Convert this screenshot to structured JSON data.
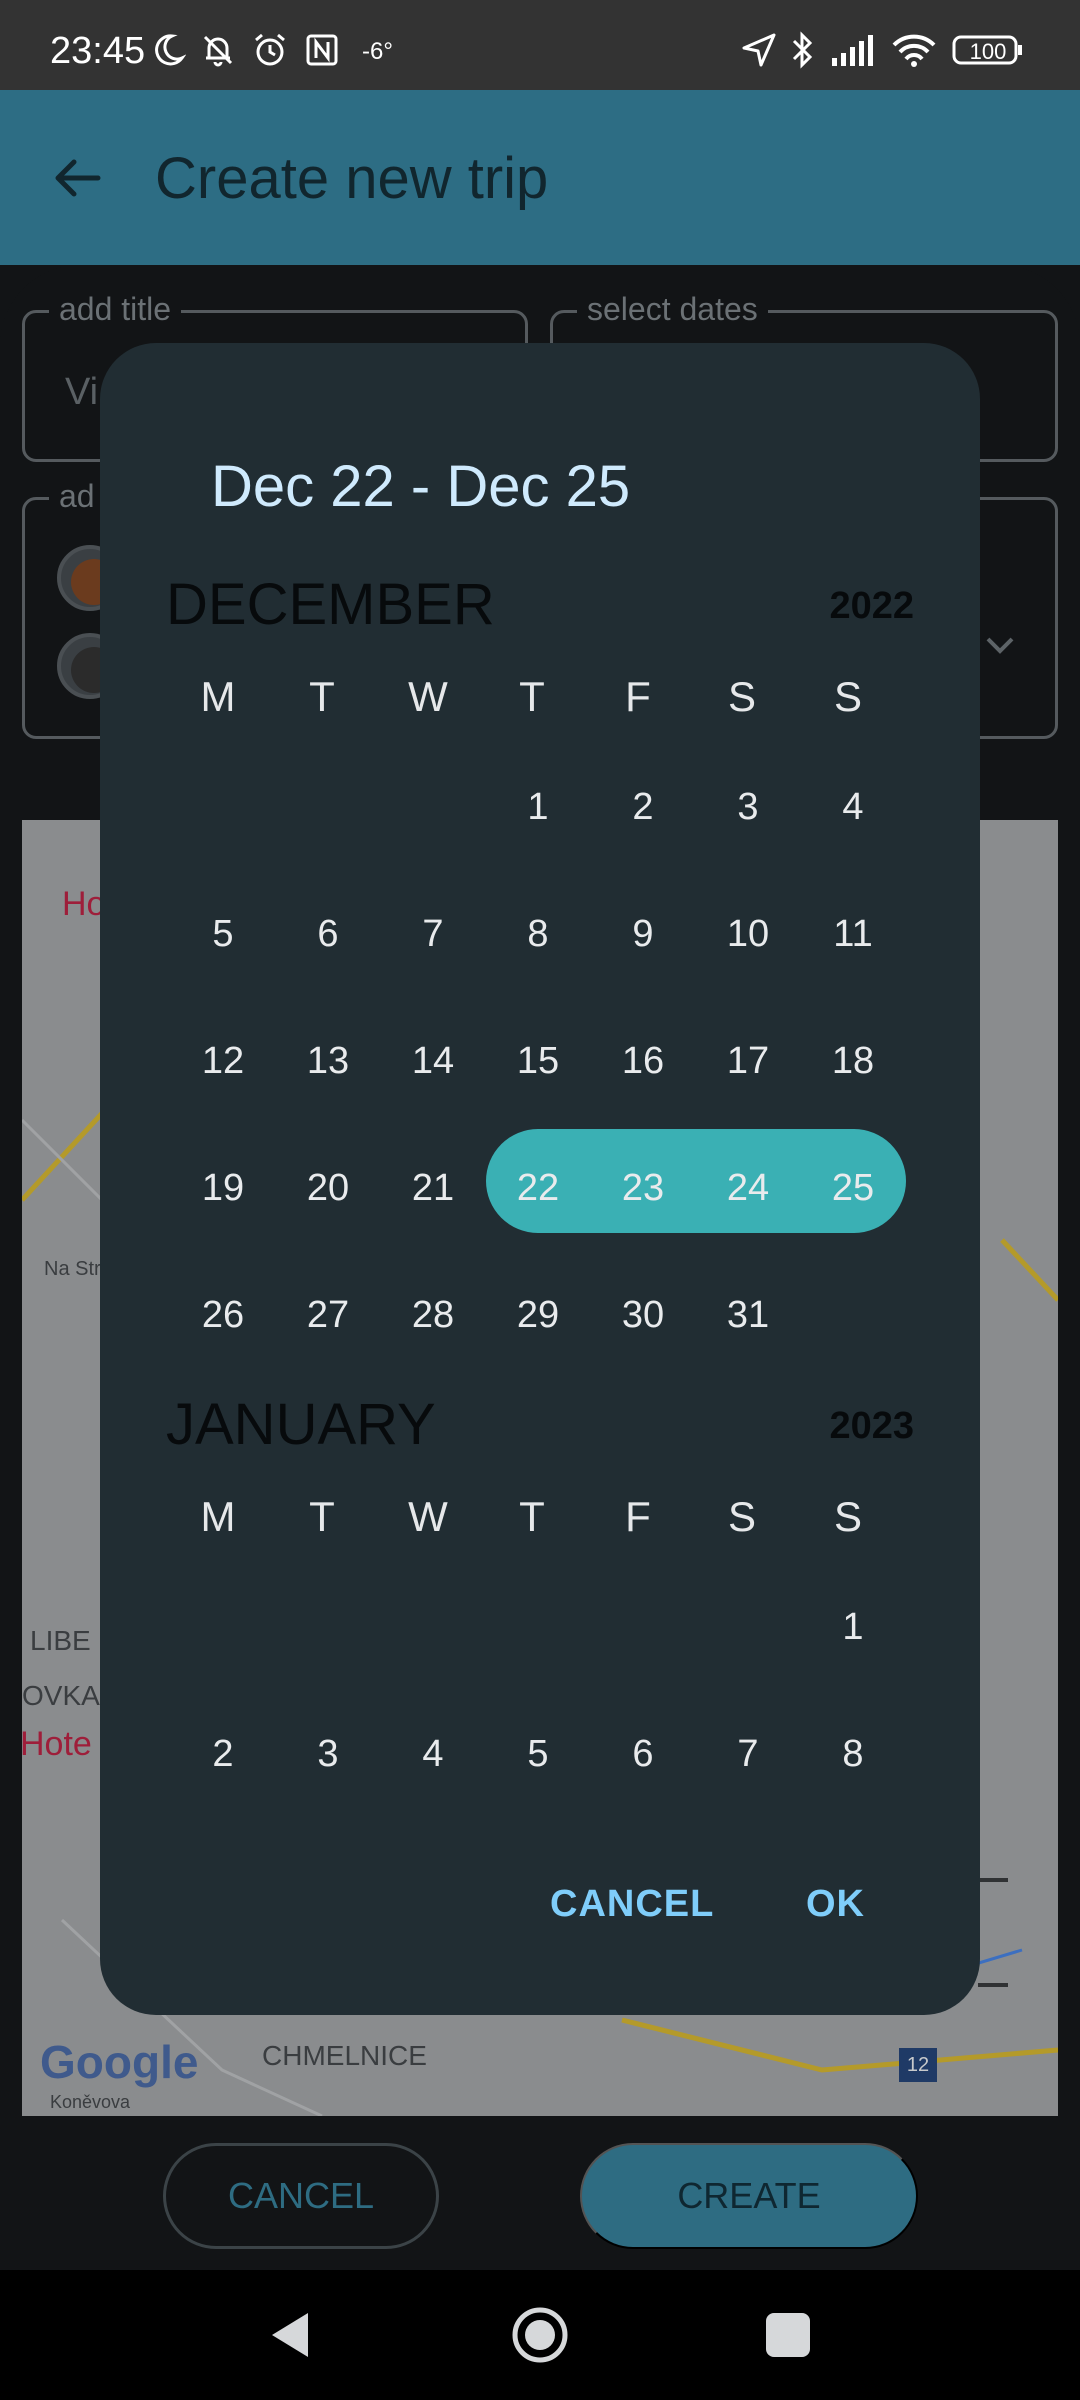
{
  "status_bar": {
    "time": "23:45",
    "temperature": "-6°",
    "battery": "100"
  },
  "header": {
    "title": "Create new trip"
  },
  "form": {
    "title_legend": "add title",
    "title_value": "Vi",
    "dates_legend": "select dates",
    "members_legend": "ad"
  },
  "map": {
    "labels": [
      "Ho",
      "Na Str",
      "LIBE",
      "OVKA",
      "Hote",
      "CHMELNICE",
      "Koněvova"
    ],
    "google": "Google",
    "badge": "12"
  },
  "dialog": {
    "range_title": "Dec 22 - Dec 25",
    "weekdays": [
      "M",
      "T",
      "W",
      "T",
      "F",
      "S",
      "S"
    ],
    "months": [
      {
        "name": "DECEMBER",
        "year": "2022",
        "weeks": [
          [
            "",
            "",
            "",
            "1",
            "2",
            "3",
            "4"
          ],
          [
            "5",
            "6",
            "7",
            "8",
            "9",
            "10",
            "11"
          ],
          [
            "12",
            "13",
            "14",
            "15",
            "16",
            "17",
            "18"
          ],
          [
            "19",
            "20",
            "21",
            "22",
            "23",
            "24",
            "25"
          ],
          [
            "26",
            "27",
            "28",
            "29",
            "30",
            "31",
            ""
          ]
        ]
      },
      {
        "name": "JANUARY",
        "year": "2023",
        "weeks": [
          [
            "",
            "",
            "",
            "",
            "",
            "",
            "1"
          ],
          [
            "2",
            "3",
            "4",
            "5",
            "6",
            "7",
            "8"
          ]
        ]
      }
    ],
    "cancel_label": "CANCEL",
    "ok_label": "OK",
    "selected_color": "#3ab0b4"
  },
  "footer": {
    "cancel_label": "CANCEL",
    "create_label": "CREATE"
  },
  "colors": {
    "header_bg": "#2d6d84",
    "dialog_bg": "#212d33",
    "accent_text": "#7fcdfa"
  }
}
